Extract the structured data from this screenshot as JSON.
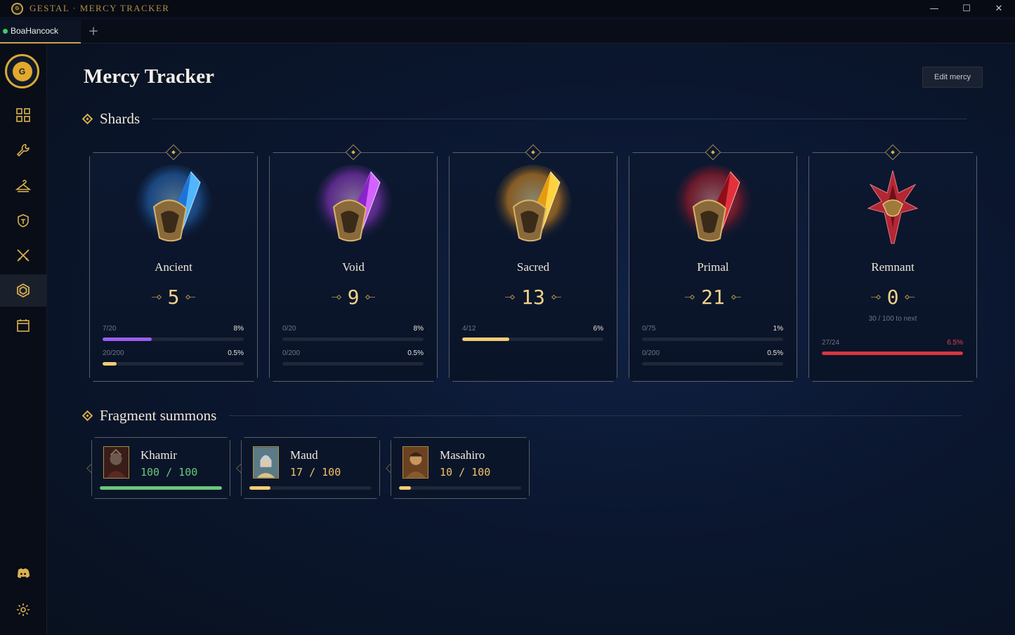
{
  "window": {
    "title": "GESTAL · MERCY TRACKER",
    "minimize": "—",
    "maximize": "☐",
    "close": "✕"
  },
  "tabs": [
    {
      "label": "BoaHancock",
      "status_color": "#3fcb6b"
    }
  ],
  "tab_add": "+",
  "sidebar": {
    "items": [
      {
        "icon": "grid-icon"
      },
      {
        "icon": "wrench-icon"
      },
      {
        "icon": "hanger-icon"
      },
      {
        "icon": "champion-helmet-icon"
      },
      {
        "icon": "crossed-swords-icon"
      },
      {
        "icon": "shard-hexagon-icon",
        "active": true
      },
      {
        "icon": "calendar-icon"
      },
      {
        "icon": "discord-icon"
      },
      {
        "icon": "gear-icon"
      }
    ]
  },
  "page": {
    "title": "Mercy Tracker",
    "edit_button": "Edit mercy"
  },
  "sections": {
    "shards": "Shards",
    "fragments": "Fragment summons"
  },
  "shards": [
    {
      "name": "Ancient",
      "count": "5",
      "color": "#3b9bff",
      "bars": [
        {
          "left": "7/20",
          "right": "8%",
          "progress": 0.35,
          "color": "#9b5ff0"
        },
        {
          "left": "20/200",
          "right": "0.5%",
          "progress": 0.1,
          "color": "#f2cd74"
        }
      ]
    },
    {
      "name": "Void",
      "count": "9",
      "color": "#c44bff",
      "bars": [
        {
          "left": "0/20",
          "right": "8%",
          "progress": 0,
          "color": "#9b5ff0"
        },
        {
          "left": "0/200",
          "right": "0.5%",
          "progress": 0,
          "color": "#f2cd74"
        }
      ]
    },
    {
      "name": "Sacred",
      "count": "13",
      "color": "#ffc124",
      "bars": [
        {
          "left": "4/12",
          "right": "6%",
          "progress": 0.333,
          "color": "#f2cd74"
        }
      ]
    },
    {
      "name": "Primal",
      "count": "21",
      "color": "#e0242d",
      "bars": [
        {
          "left": "0/75",
          "right": "1%",
          "progress": 0,
          "color": "#f2cd74"
        },
        {
          "left": "0/200",
          "right": "0.5%",
          "progress": 0,
          "color": "#f2cd74"
        }
      ]
    },
    {
      "name": "Remnant",
      "count": "0",
      "color": "#b82a36",
      "sub": "30 / 100 to next",
      "bars": [
        {
          "left": "27/24",
          "right": "6.5%",
          "progress": 1,
          "color": "#d8363f",
          "right_color": "#e0454d"
        }
      ]
    }
  ],
  "fragments": [
    {
      "name": "Khamir",
      "value": "100 / 100",
      "progress": 1.0,
      "color": "#6cc77b",
      "done": true
    },
    {
      "name": "Maud",
      "value": "17 / 100",
      "progress": 0.17,
      "color": "#f2cd74",
      "done": false
    },
    {
      "name": "Masahiro",
      "value": "10 / 100",
      "progress": 0.1,
      "color": "#f2cd74",
      "done": false
    }
  ]
}
